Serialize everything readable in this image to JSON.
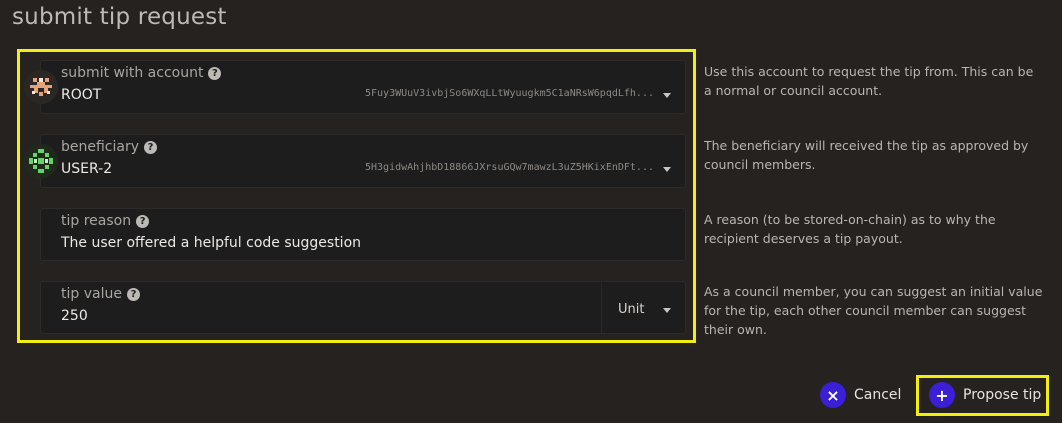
{
  "page_title": "submit tip request",
  "fields": {
    "account": {
      "label": "submit with account",
      "value": "ROOT",
      "address": "5Fuy3WUuV3ivbjSo6WXqLLtWyuugkm5C1aNRsW6pqdLfh...",
      "help_icon": "help-circle-icon"
    },
    "beneficiary": {
      "label": "beneficiary",
      "value": "USER-2",
      "address": "5H3gidwAhjhbD18866JXrsuGQw7mawzL3uZ5HKixEnDFt...",
      "help_icon": "help-circle-icon"
    },
    "reason": {
      "label": "tip reason",
      "value": "The user offered a helpful code suggestion",
      "help_icon": "help-circle-icon"
    },
    "tip_value": {
      "label": "tip value",
      "value": "250",
      "unit": "Unit",
      "help_icon": "help-circle-icon"
    }
  },
  "help": {
    "account": "Use this account to request the tip from. This can be a normal or council account.",
    "beneficiary": "The beneficiary will received the tip as approved by council members.",
    "reason": "A reason (to be stored-on-chain) as to why the recipient deserves a tip payout.",
    "tip_value": "As a council member, you can suggest an initial value for the tip, each other council member can suggest their own."
  },
  "actions": {
    "cancel_label": "Cancel",
    "propose_label": "Propose tip"
  },
  "colors": {
    "background": "#26221f",
    "highlight": "#f2ee0e",
    "button_accent": "#3a1fd6"
  }
}
